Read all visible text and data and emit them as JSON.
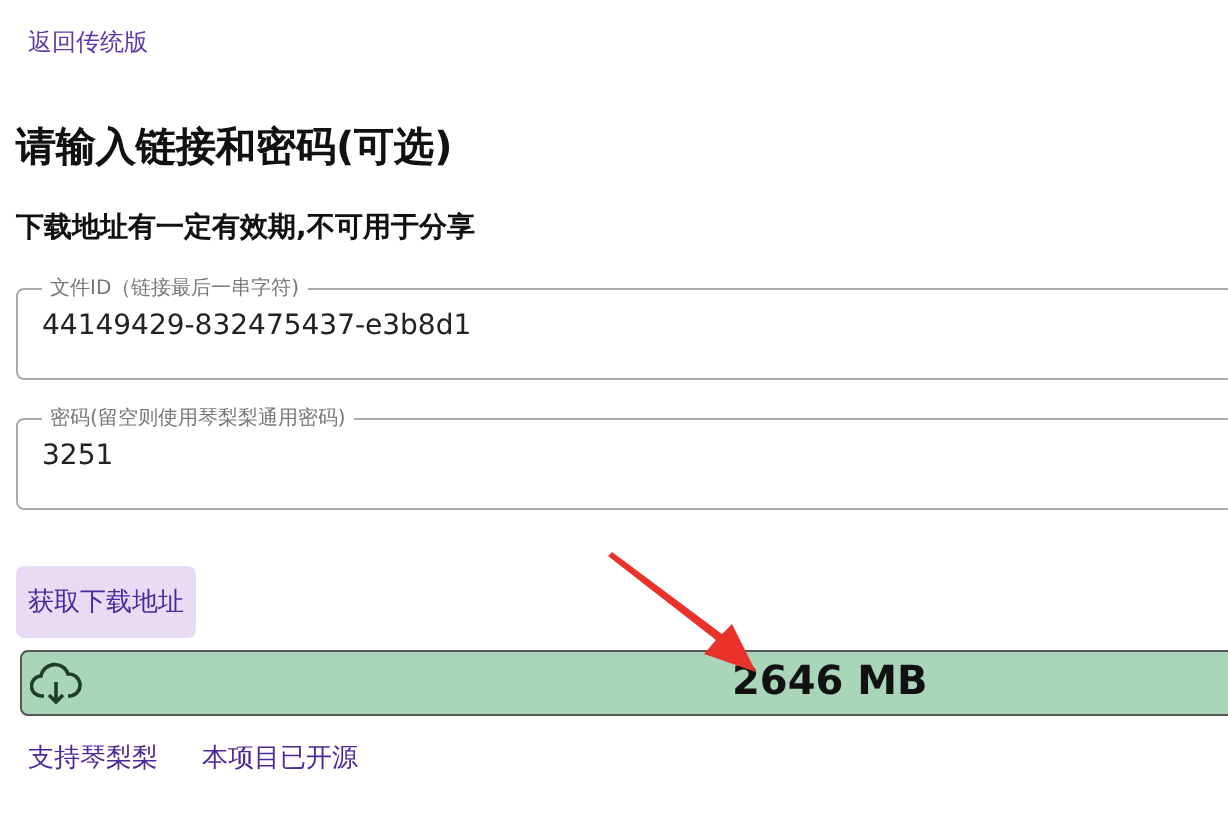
{
  "back_link": "返回传统版",
  "heading": "请输入链接和密码(可选)",
  "notice": "下载地址有一定有效期,不可用于分享",
  "fields": [
    {
      "label": "文件ID（链接最后一串字符)",
      "value": "44149429-832475437-e3b8d1"
    },
    {
      "label": "密码(留空则使用琴梨梨通用密码)",
      "value": "3251"
    }
  ],
  "get_button": "获取下载地址",
  "download": {
    "size": "2646 MB"
  },
  "footer_links": [
    "支持琴梨梨",
    "本项目已开源"
  ]
}
